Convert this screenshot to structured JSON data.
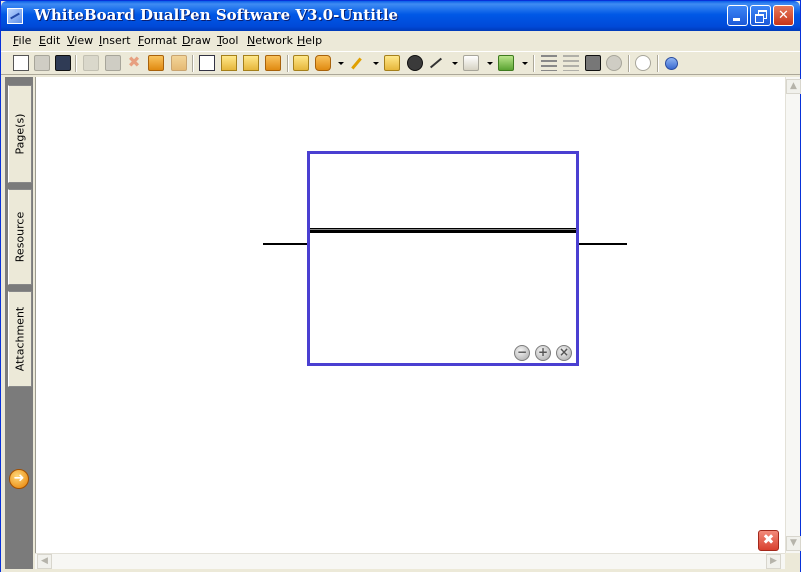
{
  "window": {
    "title": "WhiteBoard DualPen Software V3.0-Untitle",
    "title_bar_color": "#0058e6",
    "minimize_icon": "minimize-icon",
    "maximize_icon": "restore-icon",
    "close_label": "✕"
  },
  "menu": {
    "items": [
      {
        "ul": "F",
        "rest": "ile"
      },
      {
        "ul": "E",
        "rest": "dit"
      },
      {
        "ul": "V",
        "rest": "iew"
      },
      {
        "ul": "I",
        "rest": "nsert"
      },
      {
        "ul": "F",
        "rest": "ormat"
      },
      {
        "ul": "D",
        "rest": "raw"
      },
      {
        "ul": "T",
        "rest": "ool"
      },
      {
        "ul": "N",
        "rest": "etwork"
      },
      {
        "ul": "H",
        "rest": "elp"
      }
    ]
  },
  "toolbar": {
    "icons": [
      "new-page-icon",
      "open-icon",
      "save-icon",
      "copy-icon",
      "paste-icon",
      "delete-icon",
      "undo-icon",
      "redo-icon",
      "insert-page-icon",
      "previous-page-icon",
      "next-page-icon",
      "last-page-icon",
      "select-icon",
      "eraser-icon",
      "pen-icon",
      "highlighter-icon",
      "brush-icon",
      "line-icon",
      "shape-icon",
      "fill-icon",
      "line-style-icon",
      "dash-style-icon",
      "fill-color-icon",
      "transparency-icon",
      "spotlight-icon",
      "collapse-toolbar-icon"
    ],
    "delete_glyph": "✖"
  },
  "side_panel": {
    "tabs": [
      {
        "label": "Page(s)"
      },
      {
        "label": "Resource"
      },
      {
        "label": "Attachment"
      }
    ],
    "go_button_glyph": "➜",
    "background_color": "#7b7b7b"
  },
  "canvas": {
    "widget": {
      "border_color": "#4a3fd1",
      "controls": {
        "minus": "−",
        "plus": "+",
        "close": "×"
      }
    },
    "close_page_glyph": "✖"
  },
  "scrollbar": {
    "up_arrow": "▲",
    "down_arrow": "▼",
    "left_arrow": "◀",
    "right_arrow": "▶"
  }
}
